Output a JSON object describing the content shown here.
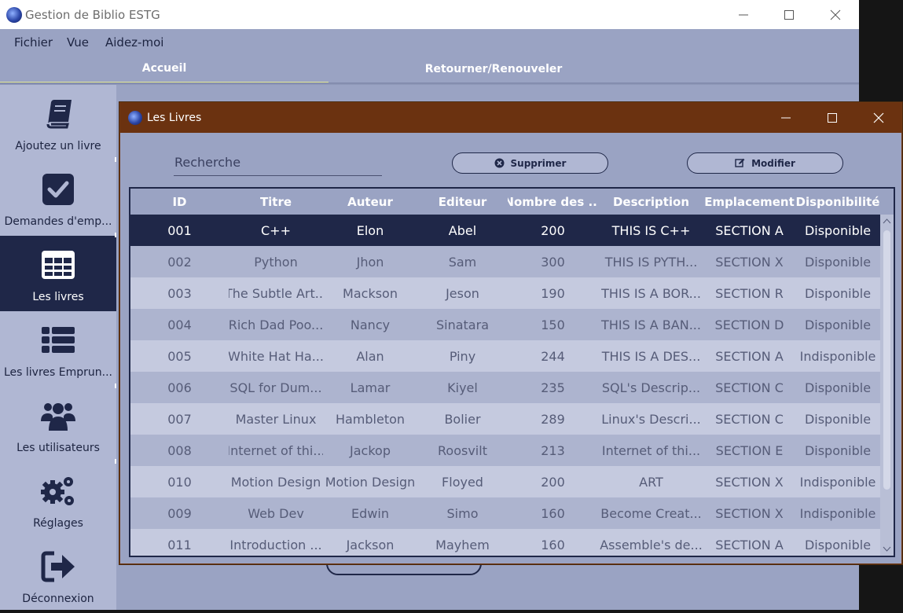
{
  "window": {
    "title": "Gestion de Biblio ESTG"
  },
  "menu": {
    "items": [
      "Fichier",
      "Vue",
      "Aidez-moi"
    ]
  },
  "tabs": [
    {
      "label": "Accueil",
      "active": true
    },
    {
      "label": "Retourner/Renouveler",
      "active": false
    }
  ],
  "sidebar": {
    "items": [
      {
        "label": "Ajoutez un livre",
        "icon": "book-icon",
        "active": false
      },
      {
        "label": "Demandes d'emp...",
        "icon": "checkbox-icon",
        "active": false
      },
      {
        "label": "Les livres",
        "icon": "table-icon",
        "active": true
      },
      {
        "label": "Les livres Emprun...",
        "icon": "list-icon",
        "active": false
      },
      {
        "label": "Les utilisateurs",
        "icon": "users-icon",
        "active": false
      },
      {
        "label": "Réglages",
        "icon": "gears-icon",
        "active": false
      },
      {
        "label": "Déconnexion",
        "icon": "logout-icon",
        "active": false
      }
    ]
  },
  "dialog": {
    "title": "Les Livres",
    "search_placeholder": "Recherche",
    "delete_label": "Supprimer",
    "edit_label": "Modifier",
    "columns": [
      "ID",
      "Titre",
      "Auteur",
      "Editeur",
      "Nombre des ...",
      "Description",
      "Emplacement",
      "Disponibilité"
    ],
    "rows": [
      [
        "001",
        "C++",
        "Elon",
        "Abel",
        "200",
        "THIS IS C++",
        "SECTION A",
        "Disponible"
      ],
      [
        "002",
        "Python",
        "Jhon",
        "Sam",
        "300",
        "THIS IS PYTH...",
        "SECTION X",
        "Disponible"
      ],
      [
        "003",
        "The Subtle Art...",
        "Mackson",
        "Jeson",
        "190",
        "THIS IS A BOR...",
        "SECTION R",
        "Disponible"
      ],
      [
        "004",
        "Rich Dad Poo...",
        "Nancy",
        "Sinatara",
        "150",
        "THIS IS A BAN...",
        "SECTION D",
        "Disponible"
      ],
      [
        "005",
        "White Hat Ha...",
        "Alan",
        "Piny",
        "244",
        "THIS IS A DES...",
        "SECTION A",
        "Indisponible"
      ],
      [
        "006",
        "SQL for Dum...",
        "Lamar",
        "Kiyel",
        "235",
        "SQL's Descrip...",
        "SECTION C",
        "Disponible"
      ],
      [
        "007",
        "Master Linux",
        "Hambleton",
        "Bolier",
        "289",
        "Linux's Descri...",
        "SECTION C",
        "Disponible"
      ],
      [
        "008",
        "Internet of thi...",
        "Jackop",
        "Roosvilt",
        "213",
        "Internet of thi...",
        "SECTION E",
        "Disponible"
      ],
      [
        "010",
        "Motion Design",
        "Motion Design",
        "Floyed",
        "200",
        "ART",
        "SECTION X",
        "Indisponible"
      ],
      [
        "009",
        "Web Dev",
        "Edwin",
        "Simo",
        "160",
        "Become Creat...",
        "SECTION X",
        "Indisponible"
      ],
      [
        "011",
        "Introduction ...",
        "Jackson",
        "Mayhem",
        "160",
        "Assemble's de...",
        "SECTION A",
        "Disponible"
      ]
    ],
    "selected_row": 0
  },
  "colors": {
    "dark_navy": "#1f2748",
    "dialog_title_bg": "#6b3210",
    "tab_underline": "#e8ec9a",
    "bg": "#9aa3c3"
  }
}
